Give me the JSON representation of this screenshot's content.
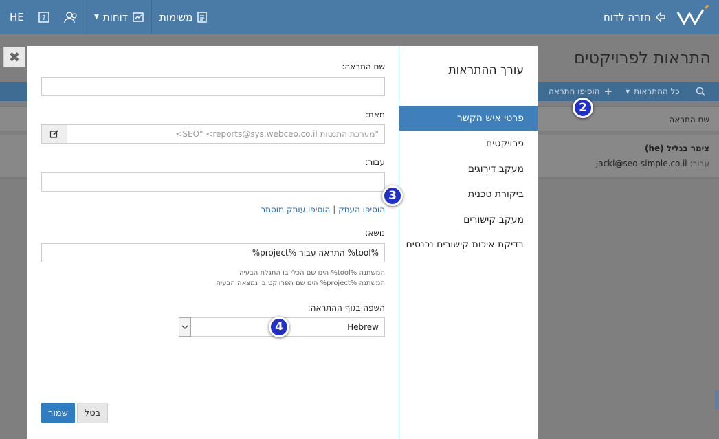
{
  "topbar": {
    "back_label": "חזרה לדוח",
    "tasks_label": "משימות",
    "reports_label": "דוחות",
    "lang_label": "HE"
  },
  "page": {
    "title": "התראות לפרויקטים",
    "all_alerts_label": "כל ההתראות",
    "add_alert_label": "הוסיפו התראה",
    "column_alert_name": "שם התראה",
    "row_name": "צימר בגליל",
    "row_lang": "(he)",
    "row_for_label": "עבור:",
    "row_email": "jacki@seo-simple.co.il"
  },
  "modal": {
    "side_title": "עורך ההתראות",
    "side_items": [
      {
        "label": "פרטי איש הקשר",
        "active": true
      },
      {
        "label": "פרויקטים",
        "active": false
      },
      {
        "label": "מעקב דירוגים",
        "active": false
      },
      {
        "label": "ביקורת טכנית",
        "active": false
      },
      {
        "label": "מעקב קישורים",
        "active": false
      },
      {
        "label": "בדיקת איכות קישורים נכנסים",
        "active": false
      }
    ],
    "form": {
      "alert_name_label": "שם התראה:",
      "alert_name_value": "",
      "from_label": "מאת:",
      "from_placeholder": "\"מערכת התנטות SEO\" <reports@sys.webceo.co.il>",
      "to_label": "עבור:",
      "to_value": "",
      "add_cc": "הוסיפו העתק",
      "link_sep": "|",
      "add_bcc": "הוסיפו עותק מוסתר",
      "subject_label": "נושא:",
      "subject_value": "%tool% התראה עבור %project%",
      "hint_tool": "המשתנה %tool% הינו שם הכלי בו התגלת הבעיה",
      "hint_project": "המשתנה %project% הינו שם הפרויקט בו נמצאה הבעיה",
      "language_label": "השפה בגוף ההתראה:",
      "language_value": "Hebrew"
    },
    "save_label": "שמור",
    "cancel_label": "בטל"
  },
  "badges": {
    "b2": "2",
    "b3": "3",
    "b4": "4"
  },
  "colors": {
    "accent": "#4a7ba6",
    "active_item": "#3f7fba",
    "badge": "#1f2fc9"
  }
}
